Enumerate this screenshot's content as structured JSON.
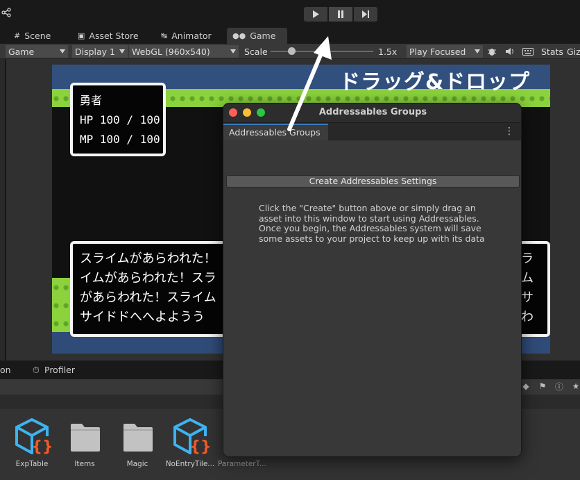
{
  "toolbar": {
    "play_icon": "play-icon",
    "pause_icon": "pause-icon",
    "step_icon": "step-icon"
  },
  "tabs": [
    {
      "label": "Scene",
      "icon": "hash-icon"
    },
    {
      "label": "Asset Store",
      "icon": "bag-icon"
    },
    {
      "label": "Animator",
      "icon": "animator-icon"
    },
    {
      "label": "Game",
      "icon": "gamepad-icon",
      "active": true
    }
  ],
  "game_toolbar": {
    "game_select": "Game",
    "display_select": "Display 1",
    "resolution_select": "WebGL (960x540)",
    "scale_label": "Scale",
    "scale_value": "1.5x",
    "play_focused_select": "Play Focused",
    "stats_label": "Stats",
    "gizmos_label": "Giz"
  },
  "game_view": {
    "overlay_title": "ドラッグ&ドロップ",
    "status": {
      "name": "勇者",
      "hp": "HP 100 / 100",
      "mp": "MP 100 / 100"
    },
    "message_lines": [
      "スライムがあらわれた！",
      "イムがあらわれた！スラ",
      "があらわれた！スライム",
      "サイドドへへよようう"
    ],
    "message_right_lines": [
      "ラ",
      "ム",
      "サ",
      "わ"
    ]
  },
  "lower_panel": {
    "tab_partial": "on",
    "tab_profiler": "Profiler",
    "assets": [
      {
        "label": "ExpTable",
        "icon": "script-asset-icon"
      },
      {
        "label": "Items",
        "icon": "folder-icon"
      },
      {
        "label": "Magic",
        "icon": "folder-icon"
      },
      {
        "label": "NoEntryTile...",
        "icon": "script-asset-icon"
      },
      {
        "label": "ParameterT..."
      }
    ]
  },
  "addressables_window": {
    "title": "Addressables Groups",
    "tab_label": "Addressables Groups",
    "create_button": "Create Addressables Settings",
    "description": "Click the \"Create\" button above or simply drag an asset into this window to start using Addressables.  Once you begin, the Addressables system will save some assets to your project to keep up with its data"
  },
  "colors": {
    "accent_tab": "#3a79bb",
    "grass": "#8bd23c",
    "sky": "#31507e",
    "traffic_close": "#ff5f57",
    "traffic_min": "#febc2e",
    "traffic_max": "#28c840"
  }
}
